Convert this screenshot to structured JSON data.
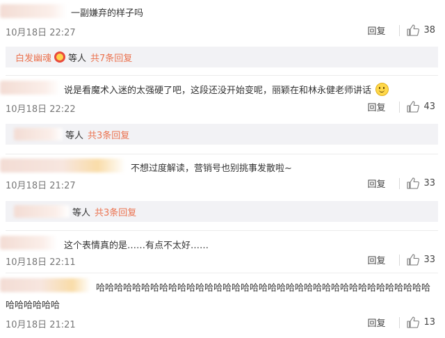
{
  "colors": {
    "accent": "#eb7350",
    "reply_bg": "#f2f2f5",
    "meta": "#777777"
  },
  "comments": [
    {
      "text": "一副嫌弃的样子吗",
      "time": "10月18日 22:27",
      "reply_label": "回复",
      "likes": "38",
      "thread": {
        "name": "白发幽魂",
        "who": "等人",
        "more": "共7条回复"
      }
    },
    {
      "text": "说是看魔术入迷的太强硬了吧，这段还没开始变呢，丽颖在和林永健老师讲话",
      "time": "10月18日 22:22",
      "reply_label": "回复",
      "likes": "43",
      "thread": {
        "who": "等人",
        "more": "共3条回复"
      }
    },
    {
      "text": "不想过度解读，营销号也别挑事发散啦~",
      "time": "10月18日 21:27",
      "reply_label": "回复",
      "likes": "33",
      "thread": {
        "who": "等人",
        "more": "共3条回复"
      }
    },
    {
      "text": "这个表情真的是……有点不太好……",
      "time": "10月18日 22:11",
      "reply_label": "回复",
      "likes": "33"
    },
    {
      "text_line1": "哈哈哈哈哈哈哈哈哈哈哈哈哈哈哈哈哈哈哈哈哈哈哈哈哈哈哈哈哈哈哈哈哈哈哈哈哈",
      "text_line2": "哈哈哈哈哈哈",
      "time": "10月18日 21:21",
      "reply_label": "回复",
      "likes": "13"
    }
  ]
}
